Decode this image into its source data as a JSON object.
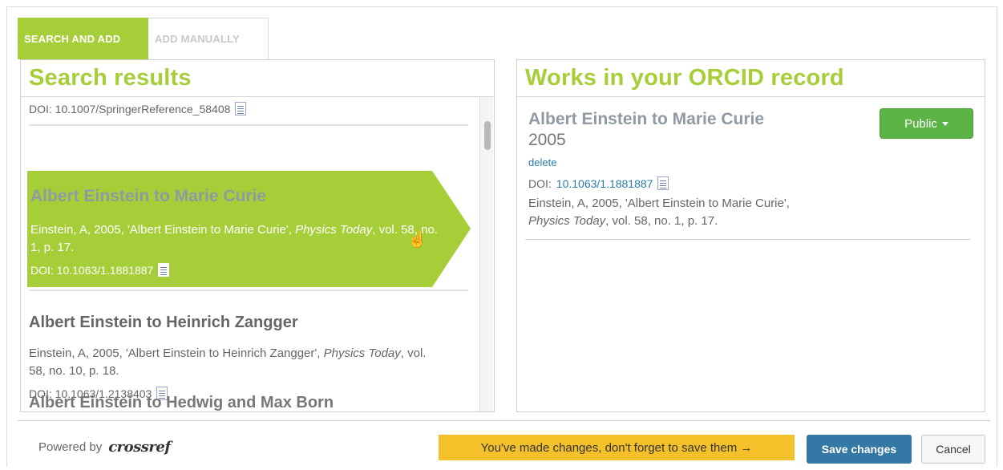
{
  "tabs": {
    "search_and_add": "SEARCH AND ADD",
    "add_manually": "ADD MANUALLY"
  },
  "search": {
    "title": "Search results",
    "top_doi": "DOI: 10.1007/SpringerReference_58408",
    "selected": {
      "title": "Albert Einstein to Marie Curie",
      "cite_plain": "Einstein, A, 2005, 'Albert Einstein to Marie Curie', ",
      "cite_journal": "Physics Today",
      "cite_rest": ", vol. 58, no. 1, p. 17.",
      "doi": "DOI: 10.1063/1.1881887"
    },
    "item2": {
      "title": "Albert Einstein to Heinrich Zangger",
      "cite_plain": "Einstein, A, 2005, 'Albert Einstein to Heinrich Zangger', ",
      "cite_journal": "Physics Today",
      "cite_rest": ", vol. 58, no. 10, p. 18.",
      "doi": "DOI: 10.1063/1.2138403"
    },
    "item3_partial_title": "Albert Einstein to Hedwig and Max Born"
  },
  "orcid": {
    "title": "Works in your ORCID record",
    "work": {
      "title": "Albert Einstein to Marie Curie",
      "year": "2005",
      "delete_label": "delete",
      "doi_prefix": "DOI: ",
      "doi": "10.1063/1.1881887",
      "cite_plain": "Einstein, A, 2005, 'Albert Einstein to Marie Curie', ",
      "cite_journal": "Physics Today",
      "cite_rest": ", vol. 58, no. 1, p. 17."
    },
    "visibility_label": "Public"
  },
  "footer": {
    "powered_by": "Powered by",
    "crossref": "crossref",
    "notice": "You've made changes, don't forget to save them →",
    "save_label": "Save changes",
    "cancel_label": "Cancel"
  },
  "colors": {
    "accent_green": "#a6ce39",
    "public_green": "#5cb346",
    "save_blue": "#3479a5",
    "notice_yellow": "#f5c12a"
  }
}
